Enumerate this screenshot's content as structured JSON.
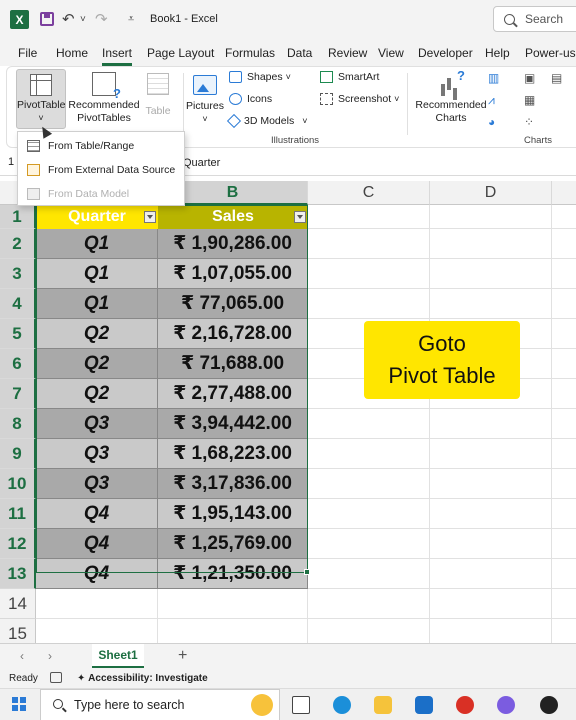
{
  "title": {
    "text": "Book1  -  Excel",
    "search_placeholder": "Search"
  },
  "tabs": [
    "File",
    "Home",
    "Insert",
    "Page Layout",
    "Formulas",
    "Data",
    "Review",
    "View",
    "Developer",
    "Help",
    "Power-use"
  ],
  "ribbon": {
    "pivottable": "PivotTable",
    "recommended_pivottables": [
      "Recommended",
      "PivotTables"
    ],
    "table": "Table",
    "pictures": "Pictures",
    "shapes": "Shapes",
    "icons": "Icons",
    "models_3d": "3D Models",
    "smartart": "SmartArt",
    "screenshot": "Screenshot",
    "illustrations_group": "Illustrations",
    "recommended_charts": [
      "Recommended",
      "Charts"
    ],
    "charts_group": "Charts"
  },
  "dropdown": {
    "items": [
      {
        "label": "From Table/Range",
        "enabled": true
      },
      {
        "label": "From External Data Source",
        "enabled": true
      },
      {
        "label": "From Data Model",
        "enabled": false
      }
    ]
  },
  "formula_bar": {
    "name_box": "1",
    "value": "Quarter"
  },
  "grid": {
    "columns": [
      "B",
      "C",
      "D"
    ],
    "rows": [
      "1",
      "2",
      "3",
      "4",
      "5",
      "6",
      "7",
      "8",
      "9",
      "10",
      "11",
      "12",
      "13",
      "14",
      "15"
    ],
    "header": {
      "quarter": "Quarter",
      "sales": "Sales"
    },
    "data": [
      {
        "quarter": "Q1",
        "sales": "₹ 1,90,286.00"
      },
      {
        "quarter": "Q1",
        "sales": "₹ 1,07,055.00"
      },
      {
        "quarter": "Q1",
        "sales": "₹ 77,065.00"
      },
      {
        "quarter": "Q2",
        "sales": "₹ 2,16,728.00"
      },
      {
        "quarter": "Q2",
        "sales": "₹ 71,688.00"
      },
      {
        "quarter": "Q2",
        "sales": "₹ 2,77,488.00"
      },
      {
        "quarter": "Q3",
        "sales": "₹ 3,94,442.00"
      },
      {
        "quarter": "Q3",
        "sales": "₹ 1,68,223.00"
      },
      {
        "quarter": "Q3",
        "sales": "₹ 3,17,836.00"
      },
      {
        "quarter": "Q4",
        "sales": "₹ 1,95,143.00"
      },
      {
        "quarter": "Q4",
        "sales": "₹ 1,25,769.00"
      },
      {
        "quarter": "Q4",
        "sales": "₹ 1,21,350.00"
      }
    ],
    "callout": [
      "Goto",
      "Pivot Table"
    ]
  },
  "sheets": {
    "active": "Sheet1"
  },
  "status": {
    "ready": "Ready",
    "accessibility": "Accessibility: Investigate"
  },
  "taskbar": {
    "search_placeholder": "Type here to search"
  },
  "colors": {
    "excel_green": "#1d6f42",
    "header_yellow": "#ffe600",
    "header_olive": "#b8b400",
    "row_light": "#c9c9c9",
    "row_dark": "#a9a9a9"
  }
}
